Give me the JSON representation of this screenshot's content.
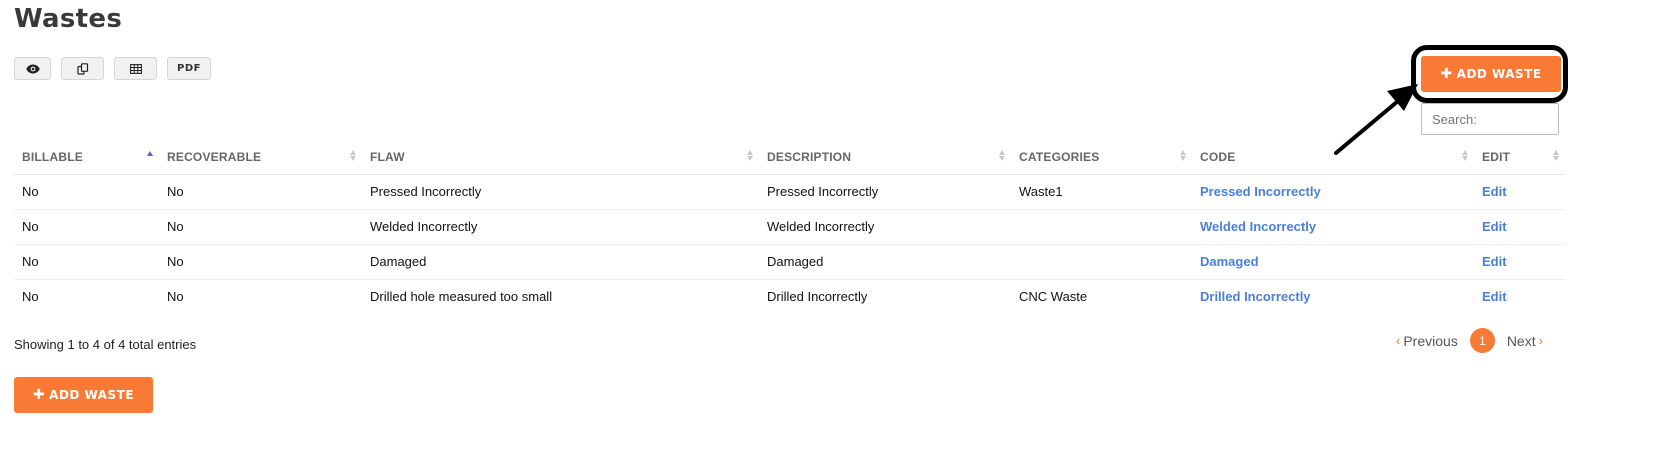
{
  "page": {
    "title": "Wastes"
  },
  "toolbar": {
    "buttons": [
      {
        "name": "eye-icon",
        "label": ""
      },
      {
        "name": "copy-icon",
        "label": ""
      },
      {
        "name": "table-icon",
        "label": ""
      },
      {
        "name": "pdf",
        "label": "PDF"
      }
    ]
  },
  "add_button": {
    "label": "ADD WASTE",
    "icon": "plus-icon"
  },
  "search": {
    "placeholder": "Search:",
    "value": ""
  },
  "table": {
    "columns": [
      "BILLABLE",
      "RECOVERABLE",
      "FLAW",
      "DESCRIPTION",
      "CATEGORIES",
      "CODE",
      "EDIT"
    ],
    "sorted_column": "BILLABLE",
    "rows": [
      {
        "billable": "No",
        "recoverable": "No",
        "flaw": "Pressed Incorrectly",
        "description": "Pressed Incorrectly",
        "categories": "Waste1",
        "code": "Pressed Incorrectly",
        "edit": "Edit"
      },
      {
        "billable": "No",
        "recoverable": "No",
        "flaw": "Welded Incorrectly",
        "description": "Welded Incorrectly",
        "categories": "",
        "code": "Welded Incorrectly",
        "edit": "Edit"
      },
      {
        "billable": "No",
        "recoverable": "No",
        "flaw": "Damaged",
        "description": "Damaged",
        "categories": "",
        "code": "Damaged",
        "edit": "Edit"
      },
      {
        "billable": "No",
        "recoverable": "No",
        "flaw": "Drilled hole measured too small",
        "description": "Drilled Incorrectly",
        "categories": "CNC Waste",
        "code": "Drilled Incorrectly",
        "edit": "Edit"
      }
    ]
  },
  "info": {
    "text": "Showing 1 to 4 of 4 total entries"
  },
  "pagination": {
    "previous": "Previous",
    "current": "1",
    "next": "Next"
  },
  "colors": {
    "accent": "#f97a34",
    "link": "#4a7fd6",
    "sort_active": "#5b5fd6"
  }
}
